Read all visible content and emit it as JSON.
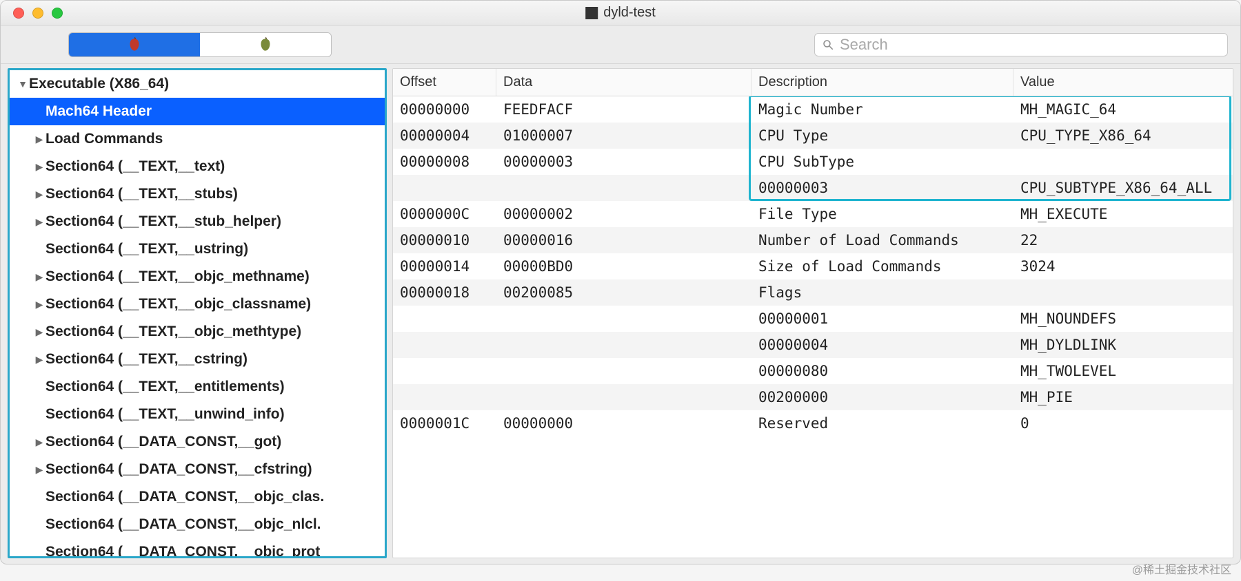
{
  "window": {
    "title": "dyld-test"
  },
  "search": {
    "placeholder": "Search"
  },
  "sidebar": {
    "root": {
      "label": "Executable  (X86_64)",
      "expanded": true
    },
    "items": [
      {
        "label": "Mach64 Header",
        "selected": true,
        "hasChildren": false
      },
      {
        "label": "Load Commands",
        "hasChildren": true
      },
      {
        "label": "Section64 (__TEXT,__text)",
        "hasChildren": true
      },
      {
        "label": "Section64 (__TEXT,__stubs)",
        "hasChildren": true
      },
      {
        "label": "Section64 (__TEXT,__stub_helper)",
        "hasChildren": true
      },
      {
        "label": "Section64 (__TEXT,__ustring)",
        "hasChildren": false
      },
      {
        "label": "Section64 (__TEXT,__objc_methname)",
        "hasChildren": true
      },
      {
        "label": "Section64 (__TEXT,__objc_classname)",
        "hasChildren": true
      },
      {
        "label": "Section64 (__TEXT,__objc_methtype)",
        "hasChildren": true
      },
      {
        "label": "Section64 (__TEXT,__cstring)",
        "hasChildren": true
      },
      {
        "label": "Section64 (__TEXT,__entitlements)",
        "hasChildren": false
      },
      {
        "label": "Section64 (__TEXT,__unwind_info)",
        "hasChildren": false
      },
      {
        "label": "Section64 (__DATA_CONST,__got)",
        "hasChildren": true
      },
      {
        "label": "Section64 (__DATA_CONST,__cfstring)",
        "hasChildren": true
      },
      {
        "label": "Section64 (__DATA_CONST,__objc_clas.",
        "hasChildren": false
      },
      {
        "label": "Section64 (__DATA_CONST,__objc_nlcl.",
        "hasChildren": false
      },
      {
        "label": "Section64 (__DATA_CONST,__objc_prot",
        "hasChildren": false
      }
    ]
  },
  "table": {
    "columns": [
      "Offset",
      "Data",
      "Description",
      "Value"
    ],
    "rows": [
      {
        "offset": "00000000",
        "data": "FEEDFACF",
        "desc": "Magic Number",
        "value": "MH_MAGIC_64"
      },
      {
        "offset": "00000004",
        "data": "01000007",
        "desc": "CPU Type",
        "value": "CPU_TYPE_X86_64"
      },
      {
        "offset": "00000008",
        "data": "00000003",
        "desc": "CPU SubType",
        "value": ""
      },
      {
        "offset": "",
        "data": "",
        "desc": "00000003",
        "value": "CPU_SUBTYPE_X86_64_ALL"
      },
      {
        "offset": "0000000C",
        "data": "00000002",
        "desc": "File Type",
        "value": "MH_EXECUTE"
      },
      {
        "offset": "00000010",
        "data": "00000016",
        "desc": "Number of Load Commands",
        "value": "22"
      },
      {
        "offset": "00000014",
        "data": "00000BD0",
        "desc": "Size of Load Commands",
        "value": "3024"
      },
      {
        "offset": "00000018",
        "data": "00200085",
        "desc": "Flags",
        "value": ""
      },
      {
        "offset": "",
        "data": "",
        "desc": "00000001",
        "value": "MH_NOUNDEFS"
      },
      {
        "offset": "",
        "data": "",
        "desc": "00000004",
        "value": "MH_DYLDLINK"
      },
      {
        "offset": "",
        "data": "",
        "desc": "00000080",
        "value": "MH_TWOLEVEL"
      },
      {
        "offset": "",
        "data": "",
        "desc": "00200000",
        "value": "MH_PIE"
      },
      {
        "offset": "0000001C",
        "data": "00000000",
        "desc": "Reserved",
        "value": "0"
      }
    ],
    "highlight": {
      "fromRow": 0,
      "toRow": 3,
      "fromCol": 2,
      "toCol": 3
    }
  },
  "watermark": "@稀土掘金技术社区"
}
